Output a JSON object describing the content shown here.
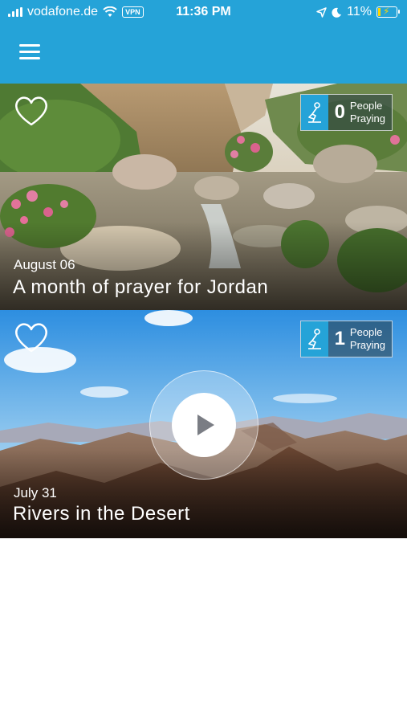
{
  "status_bar": {
    "carrier": "vodafone.de",
    "vpn": "VPN",
    "time": "11:36 PM",
    "battery": "11%"
  },
  "header": {
    "menu_icon": "hamburger-menu-icon",
    "accent": "#25a3d8"
  },
  "cards": [
    {
      "date": "August 06",
      "title": "A month of prayer for Jordan",
      "praying_count": "0",
      "praying_label_1": "People",
      "praying_label_2": "Praying",
      "has_video": false
    },
    {
      "date": "July 31",
      "title": "Rivers in the Desert",
      "praying_count": "1",
      "praying_label_1": "People",
      "praying_label_2": "Praying",
      "has_video": true
    }
  ]
}
